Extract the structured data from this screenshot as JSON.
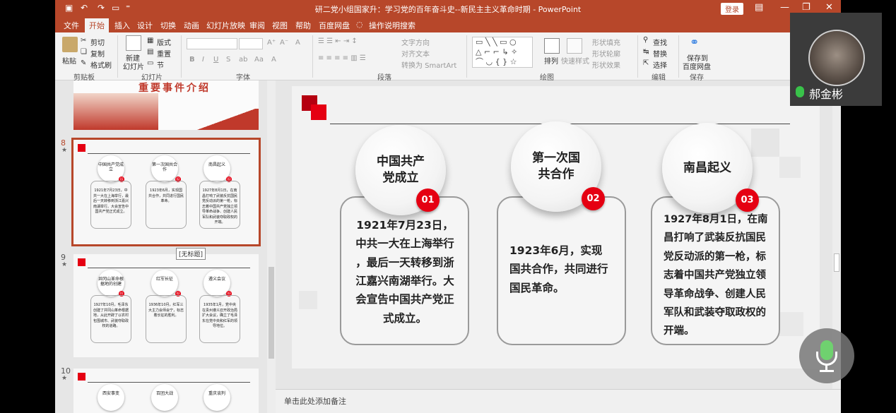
{
  "titlebar": {
    "title": "研二党小组国家升：学习党的百年奋斗史--新民主主义革命时期 - PowerPoint",
    "login": "登录",
    "qa_icons": [
      "save-icon",
      "undo-icon",
      "redo-icon",
      "present-icon",
      "customize-icon"
    ]
  },
  "tabs": [
    "文件",
    "开始",
    "插入",
    "设计",
    "切换",
    "动画",
    "幻灯片放映",
    "审阅",
    "视图",
    "帮助",
    "百度网盘",
    "操作说明搜索"
  ],
  "ribbon": {
    "clipboard": {
      "paste": "粘贴",
      "cut": "剪切",
      "copy": "复制",
      "format_painter": "格式刷",
      "label": "剪贴板"
    },
    "slides": {
      "new_slide_1": "新建",
      "new_slide_2": "幻灯片",
      "layout": "版式",
      "reset": "重置",
      "section": "节",
      "label": "幻灯片"
    },
    "font": {
      "bold": "B",
      "italic": "I",
      "underline": "U",
      "strike": "S",
      "label": "字体"
    },
    "paragraph": {
      "text_direction": "文字方向",
      "align_text": "对齐文本",
      "smartart": "转换为 SmartArt",
      "label": "段落"
    },
    "drawing": {
      "arrange": "排列",
      "quick_styles": "快速样式",
      "shape_fill": "形状填充",
      "shape_outline": "形状轮廓",
      "shape_effects": "形状效果",
      "label": "绘图"
    },
    "editing": {
      "find": "查找",
      "replace": "替换",
      "select": "选择",
      "label": "编辑"
    },
    "save": {
      "line1": "保存到",
      "line2": "百度网盘",
      "label": "保存"
    }
  },
  "thumbnails": {
    "top_partial_title": "重要事件介绍",
    "tooltip": "[无标题]",
    "slides": [
      {
        "number": "8",
        "circles": [
          "中国共产党成立",
          "第一次国共合作",
          "南昌起义"
        ],
        "dots": [
          "01",
          "02",
          "03"
        ],
        "texts": [
          "1921年7月23日，中共一大在上海举行，最后一天转移到浙江嘉兴南湖举行。大会宣告中国共产党正式成立。",
          "1923年6月，实现国共合作，共同进行国民革命。",
          "1927年8月1日，在南昌打响了武装反抗国民党反动派的第一枪，标志着中国共产党独立领导革命战争、创建人民军队和武装夺取政权的开端。"
        ]
      },
      {
        "number": "9",
        "circles": [
          "井冈山革命根据地的创建",
          "红军长征",
          "遵义会议"
        ],
        "dots": [
          "01",
          "02",
          "03"
        ],
        "texts": [
          "1927年10月，毛泽东创建了井冈山革命根据地，从此开辟了以农村包围城市、武装夺取政权的道路。",
          "1936年10月，红军三大主力会师会宁，标志着长征的胜利。",
          "1935年1月，党中央在贵州遵义召开政治局扩大会议，确立了毛泽东在党中央和红军的领导地位。"
        ]
      },
      {
        "number": "10",
        "circles": [
          "西安事变",
          "百团大战",
          "重庆谈判"
        ],
        "dots": [],
        "texts": []
      }
    ]
  },
  "slide": {
    "events": [
      {
        "title_1": "中国共产",
        "title_2": "党成立",
        "num": "01",
        "lines": [
          "1921年7月23日，",
          "中共一大在上海举行",
          "，最后一天转移到浙",
          "江嘉兴南湖举行。大",
          "会宣告中国共产党正",
          "式成立。"
        ]
      },
      {
        "title_1": "第一次国",
        "title_2": "共合作",
        "num": "02",
        "lines": [
          "1923年6月，实现",
          "国共合作，共同进行",
          "国民革命。"
        ]
      },
      {
        "title_1": "南昌起义",
        "title_2": "",
        "num": "03",
        "lines": [
          "1927年8月1日，在南",
          "昌打响了武装反抗国民",
          "党反动派的第一枪，标",
          "志着中国共产党独立领",
          "导革命战争、创建人民",
          "军队和武装夺取政权的",
          "开端。"
        ]
      }
    ]
  },
  "notes_placeholder": "单击此处添加备注",
  "video": {
    "name": "郝金彬"
  },
  "colors": {
    "accent": "#b7472a",
    "red": "#e50012"
  }
}
